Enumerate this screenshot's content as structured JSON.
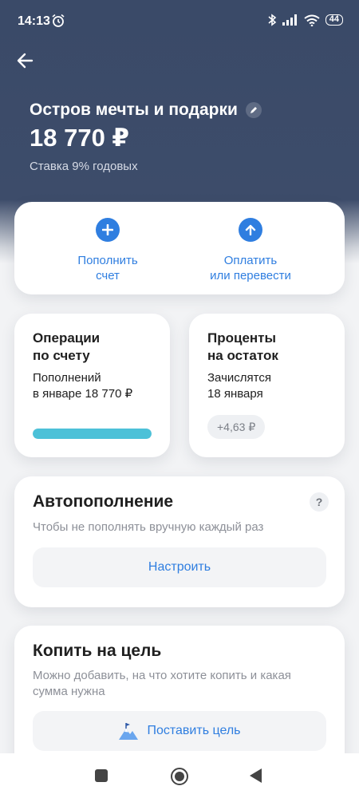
{
  "status_bar": {
    "time": "14:13",
    "battery": "44"
  },
  "header": {
    "title": "Остров мечты и подарки",
    "balance": "18 770 ₽",
    "rate": "Ставка 9% годовых"
  },
  "actions": {
    "top_up_line1": "Пополнить",
    "top_up_line2": "счет",
    "pay_line1": "Оплатить",
    "pay_line2": "или перевести"
  },
  "operations": {
    "title_line1": "Операции",
    "title_line2": "по счету",
    "text_line1": "Пополнений",
    "text_line2": "в январе 18 770 ₽",
    "progress_fraction": 1.0
  },
  "interest": {
    "title_line1": "Проценты",
    "title_line2": "на остаток",
    "text_line1": "Зачислятся",
    "text_line2": "18 января",
    "amount": "+4,63 ₽"
  },
  "autofill": {
    "title": "Автопополнение",
    "subtitle": "Чтобы не пополнять вручную каждый раз",
    "help": "?",
    "button": "Настроить"
  },
  "goal": {
    "title": "Копить на цель",
    "subtitle_line1": "Можно добавить, на что хотите копить и какая",
    "subtitle_line2": "сумма нужна",
    "button": "Поставить цель"
  },
  "colors": {
    "header_bg": "#3d4c6a",
    "accent": "#2f7ee0",
    "progress": "#4cc1d8"
  },
  "icons": [
    "alarm-icon",
    "bluetooth-icon",
    "signal-icon",
    "wifi-icon",
    "battery-icon",
    "back-arrow-icon",
    "edit-icon",
    "plus-icon",
    "arrow-up-icon",
    "question-icon",
    "mountain-flag-icon"
  ]
}
